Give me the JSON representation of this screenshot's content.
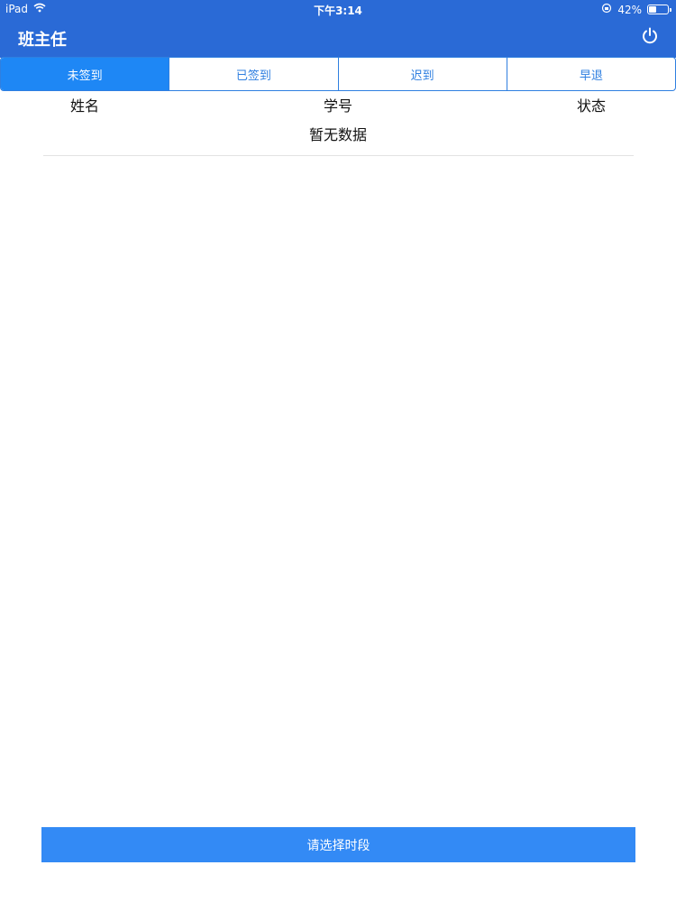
{
  "status_bar": {
    "device": "iPad",
    "time": "下午3:14",
    "battery_percent": "42%",
    "battery_level": 0.42
  },
  "nav": {
    "title": "班主任",
    "power_icon": "power-icon"
  },
  "tabs": [
    {
      "label": "未签到",
      "active": true
    },
    {
      "label": "已签到",
      "active": false
    },
    {
      "label": "迟到",
      "active": false
    },
    {
      "label": "早退",
      "active": false
    }
  ],
  "table": {
    "columns": [
      "姓名",
      "学号",
      "状态"
    ],
    "empty_text": "暂无数据"
  },
  "footer": {
    "button_label": "请选择时段"
  },
  "colors": {
    "header": "#2a6ad6",
    "tab_active": "#1e87f5",
    "tab_border": "#2f7fe0",
    "button": "#338af5"
  }
}
